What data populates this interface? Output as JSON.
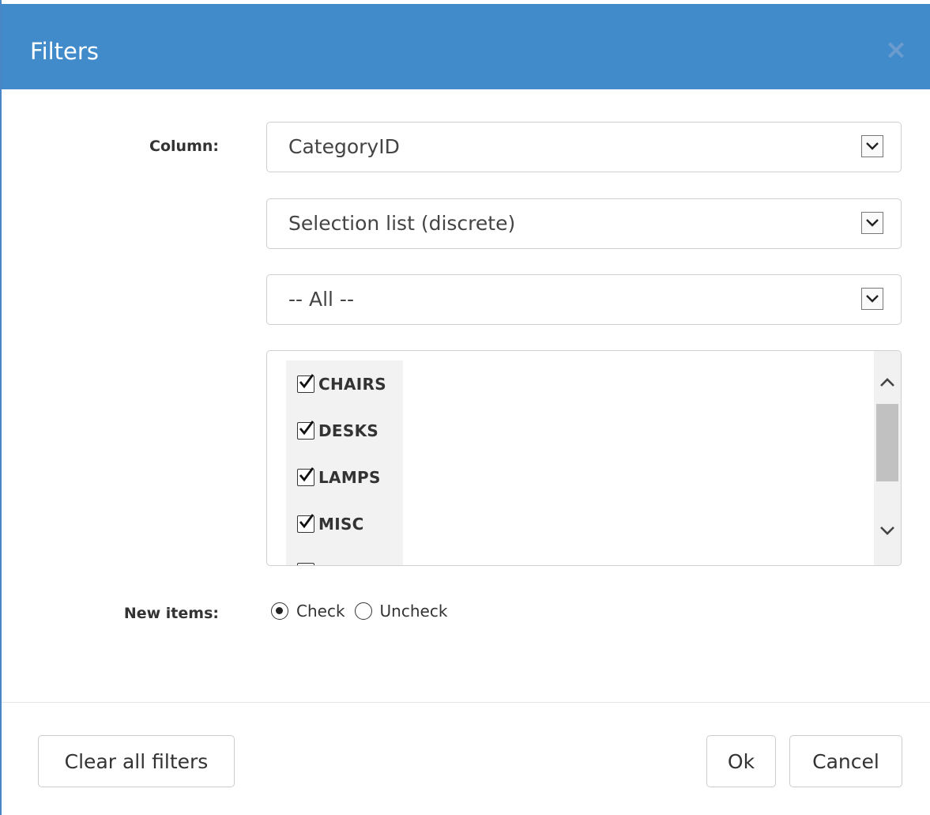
{
  "dialog": {
    "title": "Filters",
    "close_glyph": "×"
  },
  "form": {
    "column_label": "Column:",
    "column_value": "CategoryID",
    "filter_type_value": "Selection list (discrete)",
    "selection_value": "-- All --",
    "items": [
      {
        "label": "CHAIRS",
        "checked": true
      },
      {
        "label": "DESKS",
        "checked": true
      },
      {
        "label": "LAMPS",
        "checked": true
      },
      {
        "label": "MISC",
        "checked": true
      }
    ],
    "new_items_label": "New items:",
    "radio_check_label": "Check",
    "radio_uncheck_label": "Uncheck",
    "new_items_selected": "Check"
  },
  "footer": {
    "clear_label": "Clear all filters",
    "ok_label": "Ok",
    "cancel_label": "Cancel"
  },
  "colors": {
    "header_bg": "#428bca",
    "header_text": "#ffffff"
  }
}
